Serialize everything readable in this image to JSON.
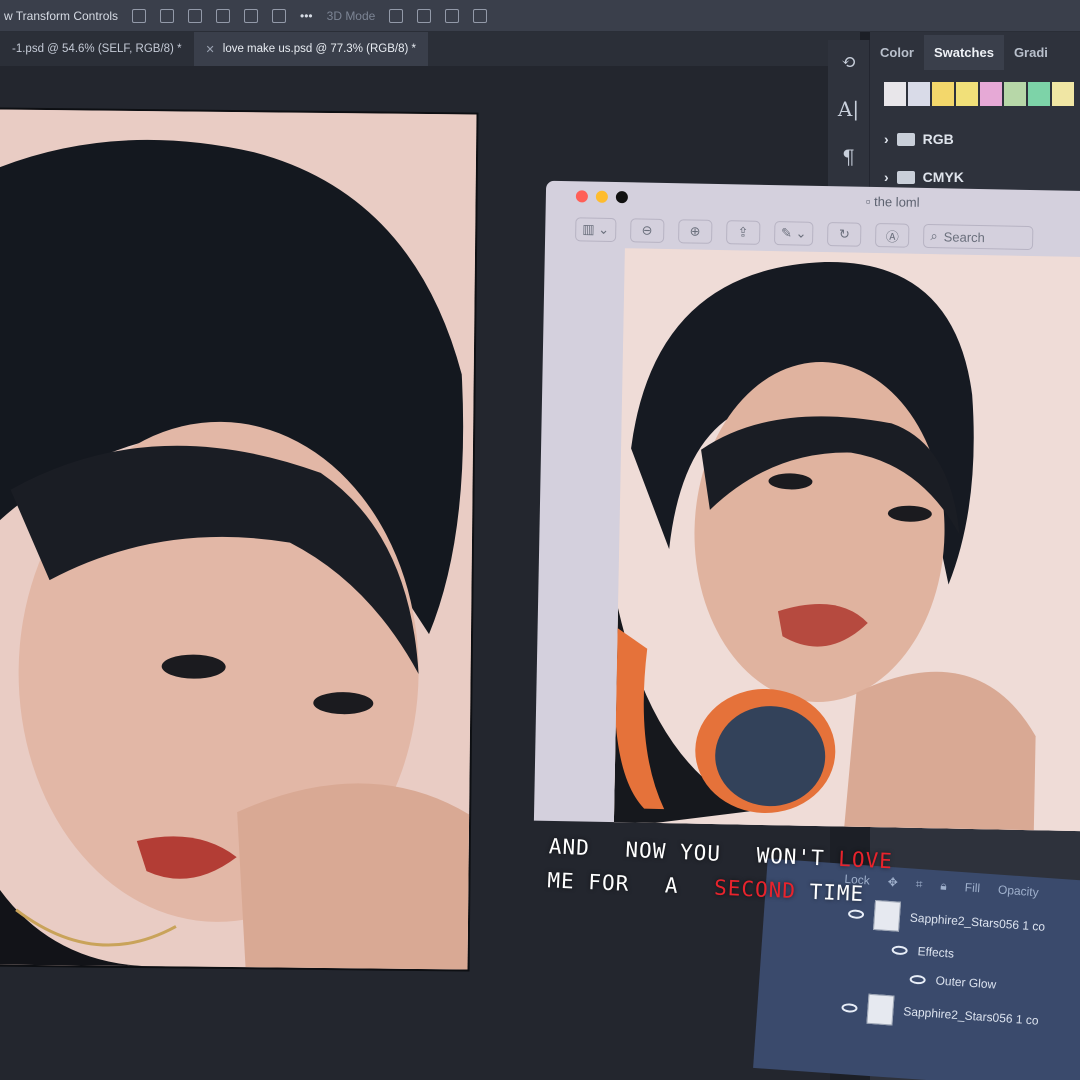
{
  "options_bar": {
    "label": "w Transform Controls",
    "mode_label": "3D Mode"
  },
  "tabs": [
    {
      "label": "-1.psd @ 54.6% (SELF, RGB/8) *"
    },
    {
      "label": "love make us.psd @ 77.3% (RGB/8) *"
    }
  ],
  "toolstrip": {
    "text_glyph": "A|",
    "paragraph_glyph": "¶"
  },
  "right_panel": {
    "tabs": [
      "Color",
      "Swatches",
      "Gradi"
    ],
    "active_tab": "Swatches",
    "swatch_colors": [
      "#e8e6ea",
      "#d9dbe8",
      "#f3d76b",
      "#f1e079",
      "#e6a9d6",
      "#b7d7a8",
      "#7dd3a8",
      "#f0e6a4"
    ],
    "groups": [
      "RGB",
      "CMYK"
    ]
  },
  "preview_window": {
    "title": "the loml",
    "search_placeholder": "Search",
    "traffic_lights": [
      "#ff5f57",
      "#febc2e",
      "#111111"
    ]
  },
  "layers_panel": {
    "lock_label": "Lock",
    "fill_label": "Fill",
    "opacity_label": "Opacity",
    "layers": [
      {
        "name": "Sapphire2_Stars056 1 co"
      },
      {
        "name": "Effects"
      },
      {
        "name": "Outer Glow"
      },
      {
        "name": "Sapphire2_Stars056 1 co"
      }
    ]
  },
  "lyrics": {
    "line1_w1": "AND",
    "line1_w2": "NOW",
    "line1_w3": "YOU",
    "line1_w4": "WON'T",
    "line1_red": "LOVE",
    "line2_w1": "ME",
    "line2_w2": "FOR",
    "line2_w3": "A",
    "line2_red": "SECOND",
    "line2_w4": "TIME",
    "accent_color": "#e8232c"
  }
}
